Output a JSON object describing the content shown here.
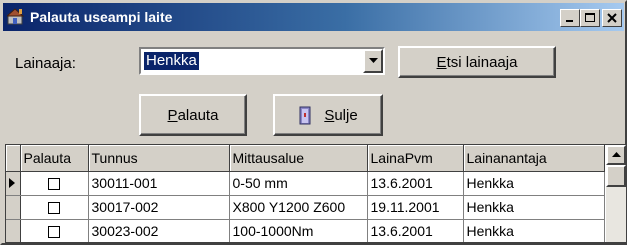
{
  "window": {
    "title": "Palauta useampi laite"
  },
  "form": {
    "lender_label": "Lainaaja:",
    "lender_value": "Henkka",
    "search_button": "Etsi lainaaja",
    "return_button": "Palauta",
    "close_button": "Sulje"
  },
  "table": {
    "columns": [
      "Palauta",
      "Tunnus",
      "Mittausalue",
      "LainaPvm",
      "Lainanantaja"
    ],
    "rows": [
      {
        "tunnus": "30011-001",
        "mittausalue": "0-50 mm",
        "lainapvm": "13.6.2001",
        "lainanantaja": "Henkka"
      },
      {
        "tunnus": "30017-002",
        "mittausalue": "X800 Y1200 Z600",
        "lainapvm": "19.11.2001",
        "lainanantaja": "Henkka"
      },
      {
        "tunnus": "30023-002",
        "mittausalue": "100-1000Nm",
        "lainapvm": "13.6.2001",
        "lainanantaja": "Henkka"
      }
    ]
  },
  "colors": {
    "title_gradient_start": "#0a246a",
    "title_gradient_end": "#a6caf0",
    "face": "#d4d0c8",
    "selection": "#0a246a"
  },
  "icons": [
    "app-icon",
    "minimize-icon",
    "maximize-icon",
    "close-icon",
    "dropdown-arrow-icon",
    "sulje-icon",
    "row-pointer-icon",
    "scroll-up-icon"
  ]
}
